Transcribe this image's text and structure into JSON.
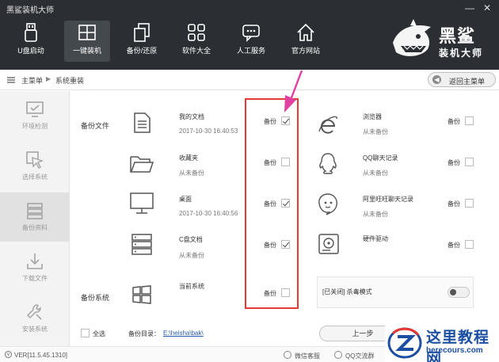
{
  "window": {
    "title": "黑鲨装机大师",
    "controls": {
      "minimize": "—",
      "close": "✕"
    }
  },
  "nav": [
    {
      "label": "U盘启动",
      "icon": "usb-icon",
      "active": false
    },
    {
      "label": "一键装机",
      "icon": "windows-icon",
      "active": true
    },
    {
      "label": "备份/还原",
      "icon": "backup-restore-icon",
      "active": false
    },
    {
      "label": "软件大全",
      "icon": "apps-grid-icon",
      "active": false
    },
    {
      "label": "人工服务",
      "icon": "chat-icon",
      "active": false
    },
    {
      "label": "官方网站",
      "icon": "home-icon",
      "active": false
    }
  ],
  "brand": {
    "name": "黑鲨",
    "subtitle": "装机大师",
    "logo_icon": "shark-logo-icon"
  },
  "breadcrumb": {
    "root": "主菜单",
    "separator": "▶",
    "current": "系统重装"
  },
  "back_button": {
    "label": "返回主菜单",
    "icon": "back-arrow-icon"
  },
  "sidebar": [
    {
      "label": "环境检测",
      "icon": "monitor-icon",
      "active": false
    },
    {
      "label": "选择系统",
      "icon": "cursor-icon",
      "active": false
    },
    {
      "label": "备份资料",
      "icon": "database-icon",
      "active": true
    },
    {
      "label": "下载文件",
      "icon": "download-icon",
      "active": false
    },
    {
      "label": "安装系统",
      "icon": "wrench-icon",
      "active": false
    }
  ],
  "sections": {
    "files": "备份文件",
    "system": "备份系统"
  },
  "backup_label": "备份",
  "items_left": [
    {
      "name": "我的文档",
      "sub": "2017-10-30 16:40:53",
      "checked": true,
      "icon": "document-icon"
    },
    {
      "name": "收藏夹",
      "sub": "从未备份",
      "checked": false,
      "icon": "folder-icon"
    },
    {
      "name": "桌面",
      "sub": "2017-10-30 16:40:56",
      "checked": true,
      "icon": "desktop-icon"
    },
    {
      "name": "C盘文档",
      "sub": "从未备份",
      "checked": true,
      "icon": "server-icon"
    }
  ],
  "system_item": {
    "name": "当前系统",
    "checked": false,
    "icon": "windows-logo-icon"
  },
  "items_right": [
    {
      "name": "浏览器",
      "sub": "从未备份",
      "checked": false,
      "icon": "ie-icon"
    },
    {
      "name": "QQ聊天记录",
      "sub": "从未备份",
      "checked": false,
      "icon": "qq-icon"
    },
    {
      "name": "阿里旺旺聊天记录",
      "sub": "从未备份",
      "checked": false,
      "icon": "wangwang-icon"
    },
    {
      "name": "硬件驱动",
      "sub": "",
      "checked": false,
      "icon": "hardware-icon"
    }
  ],
  "antivirus": {
    "label": "[已关闭] 杀毒模式",
    "enabled": false
  },
  "bottom": {
    "select_all": "全选",
    "dir_label": "备份目录：",
    "dir_path": "E:\\heisha\\bak\\",
    "prev_button": "上一步"
  },
  "status": {
    "version": "VER[11.5.45.1310]",
    "wechat": "微信客服",
    "qq": "QQ交流群"
  },
  "watermark": {
    "text": "这里教程网",
    "url": "herecours.com"
  },
  "colors": {
    "header": "#2b2f33",
    "highlight_box": "#e53935",
    "annotation_arrow": "#e040a0",
    "watermark": "#1c4fa1"
  }
}
